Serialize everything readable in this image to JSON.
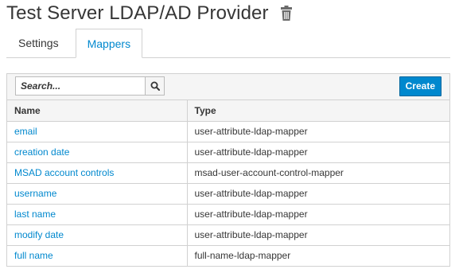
{
  "header": {
    "title": "Test Server LDAP/AD Provider",
    "delete_icon": "trash-icon"
  },
  "tabs": [
    {
      "label": "Settings",
      "active": false
    },
    {
      "label": "Mappers",
      "active": true
    }
  ],
  "toolbar": {
    "search_placeholder": "Search...",
    "search_icon": "search-icon",
    "create_label": "Create"
  },
  "table": {
    "columns": [
      "Name",
      "Type"
    ],
    "rows": [
      {
        "name": "email",
        "type": "user-attribute-ldap-mapper"
      },
      {
        "name": "creation date",
        "type": "user-attribute-ldap-mapper"
      },
      {
        "name": "MSAD account controls",
        "type": "msad-user-account-control-mapper"
      },
      {
        "name": "username",
        "type": "user-attribute-ldap-mapper"
      },
      {
        "name": "last name",
        "type": "user-attribute-ldap-mapper"
      },
      {
        "name": "modify date",
        "type": "user-attribute-ldap-mapper"
      },
      {
        "name": "full name",
        "type": "full-name-ldap-mapper"
      }
    ]
  },
  "colors": {
    "accent": "#0088ce",
    "border": "#d1d1d1",
    "toolbar_bg": "#f5f5f5"
  }
}
